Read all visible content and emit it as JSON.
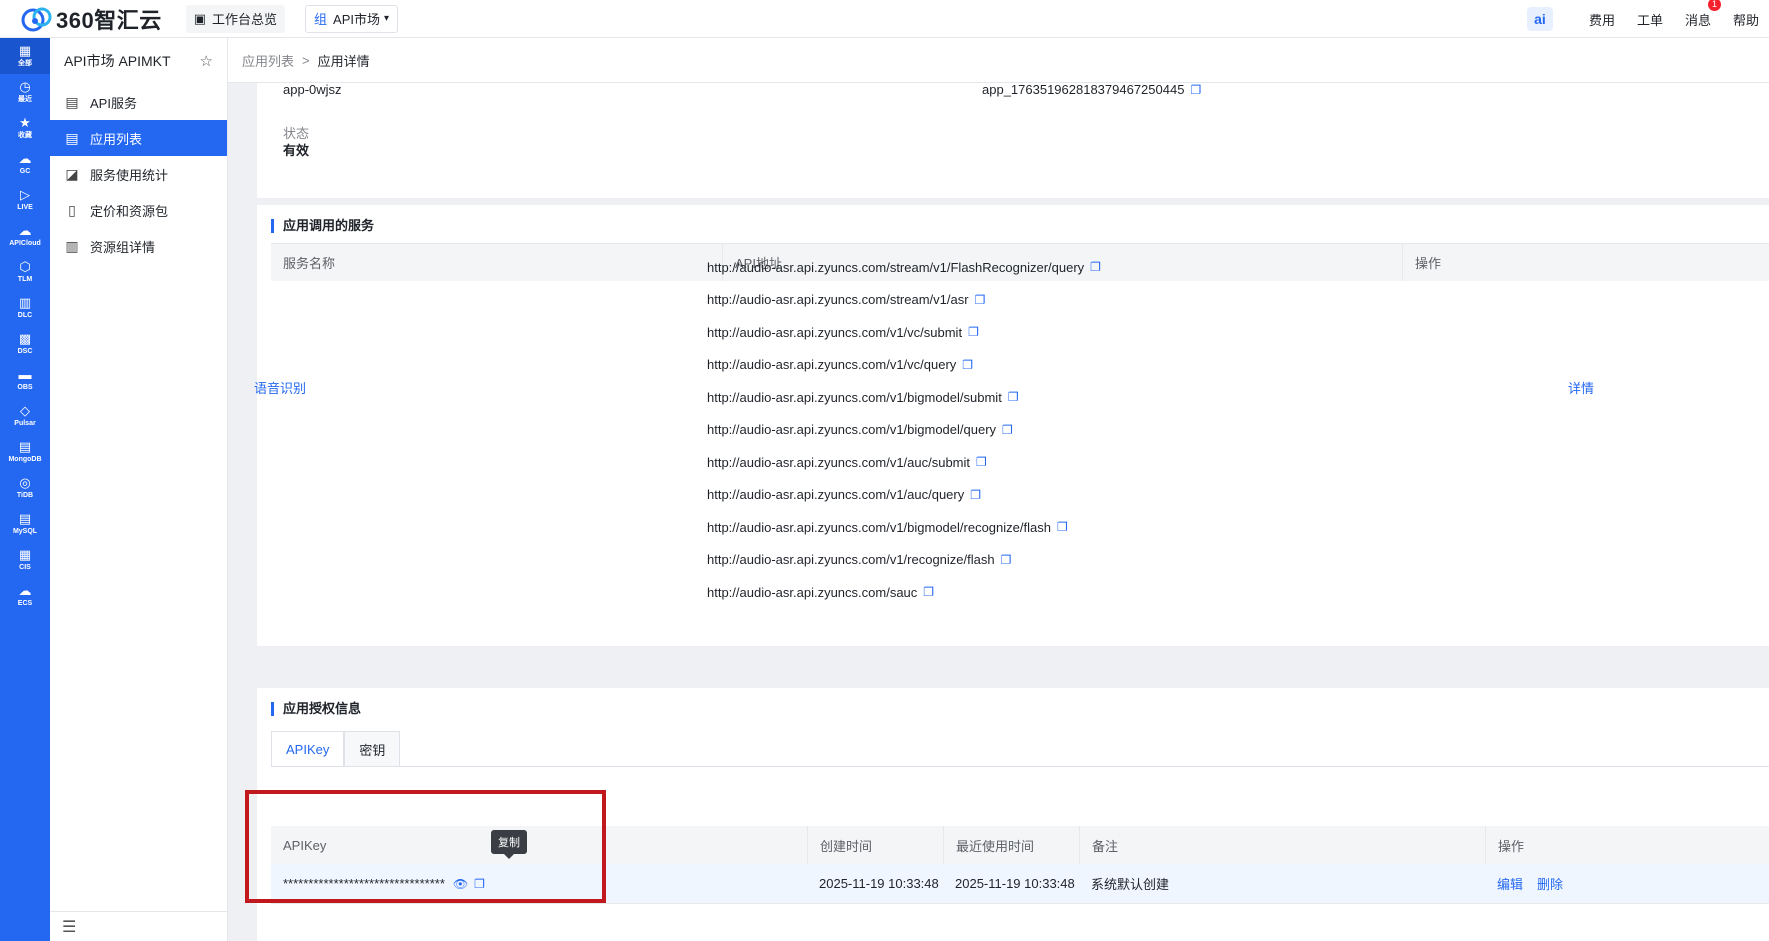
{
  "topbar": {
    "logo_text": "360智汇云",
    "workbench": "工作台总览",
    "market_tag": "组",
    "market_label": "API市场",
    "ai": "ai",
    "links": [
      "费用",
      "工单",
      "消息",
      "帮助"
    ],
    "message_badge": "1"
  },
  "rail": [
    {
      "label": "全部",
      "icon": "grid-icon"
    },
    {
      "label": "最近",
      "icon": "clock-icon"
    },
    {
      "label": "收藏",
      "icon": "star-icon"
    },
    {
      "label": "GC",
      "icon": "cloud-icon"
    },
    {
      "label": "LIVE",
      "icon": "play-icon"
    },
    {
      "label": "APICloud",
      "icon": "cloud-api-icon"
    },
    {
      "label": "TLM",
      "icon": "hex-icon"
    },
    {
      "label": "DLC",
      "icon": "columns-icon"
    },
    {
      "label": "DSC",
      "icon": "grid-dots-icon"
    },
    {
      "label": "OBS",
      "icon": "bucket-icon"
    },
    {
      "label": "Pulsar",
      "icon": "pulsar-icon"
    },
    {
      "label": "MongoDB",
      "icon": "mongo-icon"
    },
    {
      "label": "TiDB",
      "icon": "tidb-icon"
    },
    {
      "label": "MySQL",
      "icon": "mysql-icon"
    },
    {
      "label": "CIS",
      "icon": "cis-icon"
    },
    {
      "label": "ECS",
      "icon": "ecs-icon"
    }
  ],
  "sidebar": {
    "title": "API市场 APIMKT",
    "items": [
      {
        "label": "API服务"
      },
      {
        "label": "应用列表"
      },
      {
        "label": "服务使用统计"
      },
      {
        "label": "定价和资源包"
      },
      {
        "label": "资源组详情"
      }
    ]
  },
  "breadcrumb": {
    "parent": "应用列表",
    "sep": ">",
    "current": "应用详情"
  },
  "info": {
    "app_name": "app-0wjsz",
    "app_id": "app_17635196281837946725044​5",
    "status_label": "状态",
    "status_value": "有效"
  },
  "services": {
    "title": "应用调用的服务",
    "headers": [
      "服务名称",
      "API地址",
      "操作"
    ],
    "name": "语音识别",
    "action": "详情",
    "urls": [
      "http://audio-asr.api.zyuncs.com/stream/v1/FlashRecognizer/query",
      "http://audio-asr.api.zyuncs.com/stream/v1/asr",
      "http://audio-asr.api.zyuncs.com/v1/vc/submit",
      "http://audio-asr.api.zyuncs.com/v1/vc/query",
      "http://audio-asr.api.zyuncs.com/v1/bigmodel/submit",
      "http://audio-asr.api.zyuncs.com/v1/bigmodel/query",
      "http://audio-asr.api.zyuncs.com/v1/auc/submit",
      "http://audio-asr.api.zyuncs.com/v1/auc/query",
      "http://audio-asr.api.zyuncs.com/v1/bigmodel/recognize/flash",
      "http://audio-asr.api.zyuncs.com/v1/recognize/flash",
      "http://audio-asr.api.zyuncs.com/sauc"
    ]
  },
  "auth": {
    "title": "应用授权信息",
    "tabs": [
      "APIKey",
      "密钥"
    ],
    "headers": [
      "APIKey",
      "创建时间",
      "最近使用时间",
      "备注",
      "操作"
    ],
    "row": {
      "key": "********************************",
      "created": "2025-11-19 10:33:48",
      "last_used": "2025-11-19 10:33:48",
      "note": "系统默认创建",
      "edit": "编辑",
      "delete": "删除"
    },
    "tooltip": "复制"
  },
  "colors": {
    "accent": "#2468f2",
    "highlight": "#c0181d"
  }
}
